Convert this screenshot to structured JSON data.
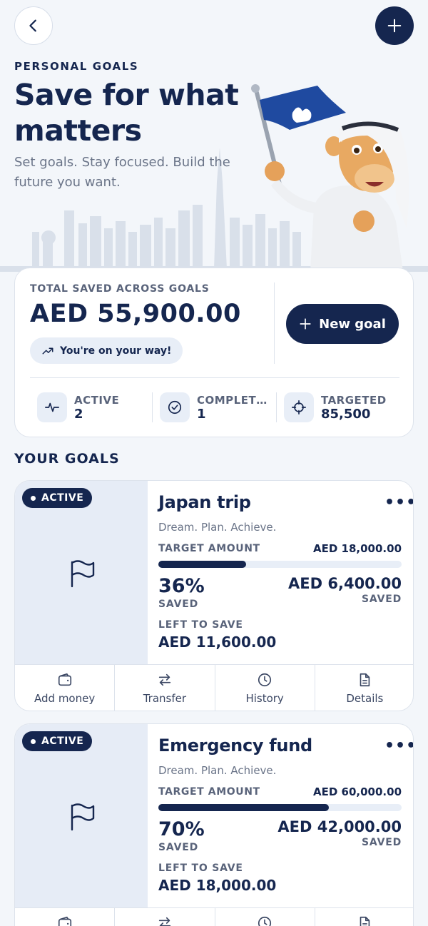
{
  "hero": {
    "eyebrow": "PERSONAL GOALS",
    "title": "Save for what matters",
    "subtitle": "Set goals. Stay focused. Build the future you want."
  },
  "summary": {
    "label": "TOTAL SAVED ACROSS GOALS",
    "value": "AED 55,900.00",
    "pill": "You're on your way!",
    "new_goal": "New goal",
    "stats": [
      {
        "label": "ACTIVE",
        "value": "2",
        "icon": "pulse-icon"
      },
      {
        "label": "COMPLET…",
        "value": "1",
        "icon": "check-circle-icon"
      },
      {
        "label": "TARGETED",
        "value": "85,500",
        "icon": "target-icon"
      }
    ]
  },
  "section_title": "YOUR GOALS",
  "goals": [
    {
      "badge": "ACTIVE",
      "title": "Japan trip",
      "subtitle": "Dream. Plan. Achieve.",
      "target_label": "TARGET AMOUNT",
      "target_value": "AED 18,000.00",
      "progress": 0.36,
      "percent": "36%",
      "percent_label": "SAVED",
      "saved_value": "AED 6,400.00",
      "saved_label": "SAVED",
      "left_label": "LEFT TO SAVE",
      "left_value": "AED 11,600.00"
    },
    {
      "badge": "ACTIVE",
      "title": "Emergency fund",
      "subtitle": "Dream. Plan. Achieve.",
      "target_label": "TARGET AMOUNT",
      "target_value": "AED 60,000.00",
      "progress": 0.7,
      "percent": "70%",
      "percent_label": "SAVED",
      "saved_value": "AED 42,000.00",
      "saved_label": "SAVED",
      "left_label": "LEFT TO SAVE",
      "left_value": "AED 18,000.00"
    }
  ],
  "actions": [
    "Add money",
    "Transfer",
    "History",
    "Details"
  ],
  "colors": {
    "primary": "#15264f",
    "background": "#f3f6fa",
    "muted": "#59637a"
  }
}
